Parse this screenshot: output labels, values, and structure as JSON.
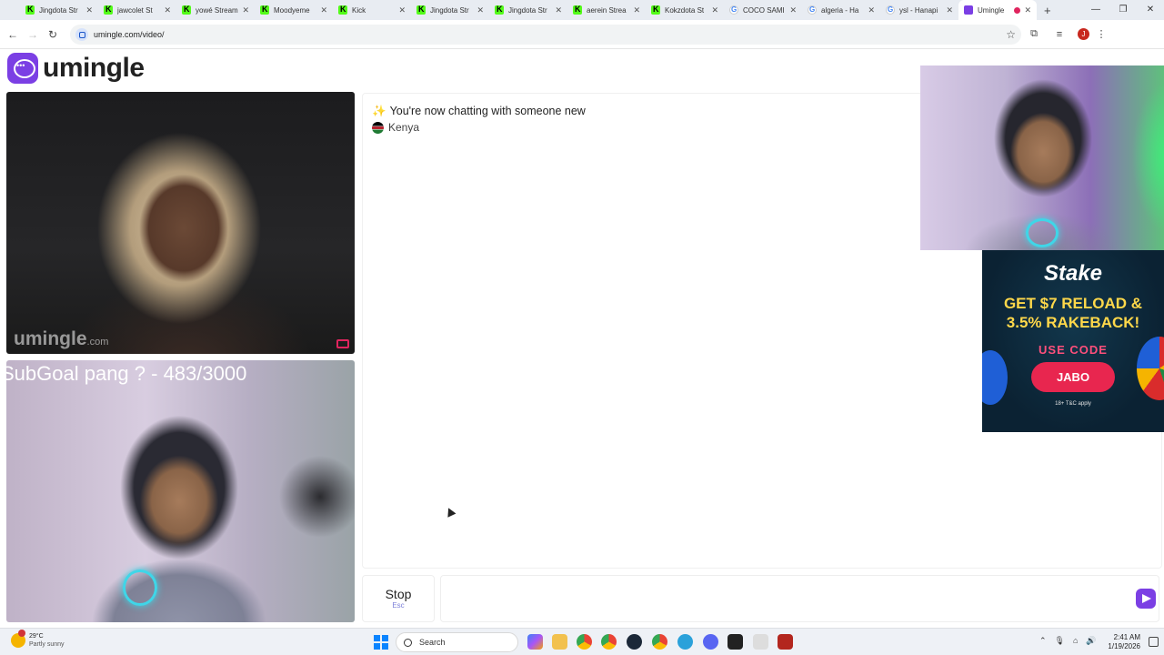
{
  "browser": {
    "tabs": [
      {
        "label": "Jingdota Str",
        "icon": "kick-icon"
      },
      {
        "label": "jawcolet St",
        "icon": "kick-icon"
      },
      {
        "label": "yowé Stream",
        "icon": "kick-icon"
      },
      {
        "label": "Moodyeme",
        "icon": "kick-icon"
      },
      {
        "label": "Kick",
        "icon": "kick-icon"
      },
      {
        "label": "Jingdota Str",
        "icon": "kick-icon"
      },
      {
        "label": "Jingdota Str",
        "icon": "kick-icon"
      },
      {
        "label": "aerein Strea",
        "icon": "kick-icon"
      },
      {
        "label": "Kokzdota St",
        "icon": "kick-icon"
      },
      {
        "label": "COCO SAMI",
        "icon": "google-icon"
      },
      {
        "label": "algeria - Ha",
        "icon": "google-icon"
      },
      {
        "label": "ysl - Hanapi",
        "icon": "google-icon"
      },
      {
        "label": "Umingle",
        "icon": "umingle-icon",
        "active": true
      }
    ],
    "new_tab": "+",
    "window_controls": {
      "minimize": "—",
      "restore": "❐",
      "close": "✕"
    },
    "nav": {
      "back": "←",
      "forward": "→",
      "reload": "↻"
    },
    "url": "umingle.com/video/",
    "profile_initial": "J"
  },
  "page": {
    "logo_text": "umingle",
    "stranger_video": {
      "watermark": "umingle",
      "watermark_suffix": ".com"
    },
    "self_video": {
      "overlay_text": "SubGoal pang ? - 483/3000"
    },
    "chat": {
      "status_icon": "✨",
      "status_text": "You're now chatting with someone new",
      "country": "Kenya"
    },
    "stop_button": {
      "label": "Stop",
      "shortcut": "Esc"
    },
    "message_input": {
      "value": "",
      "placeholder": ""
    }
  },
  "stream_overlay": {
    "ad": {
      "brand": "Stake",
      "headline_line1": "GET $7 RELOAD &",
      "headline_line2": "3.5% RAKEBACK!",
      "code_label": "USE CODE",
      "code": "JABO",
      "fine_print": "18+ T&C apply"
    }
  },
  "taskbar": {
    "weather_temp": "29°C",
    "weather_condition": "Partly sunny",
    "search_label": "Search",
    "time": "2:41 AM",
    "date": "1/19/2026"
  }
}
